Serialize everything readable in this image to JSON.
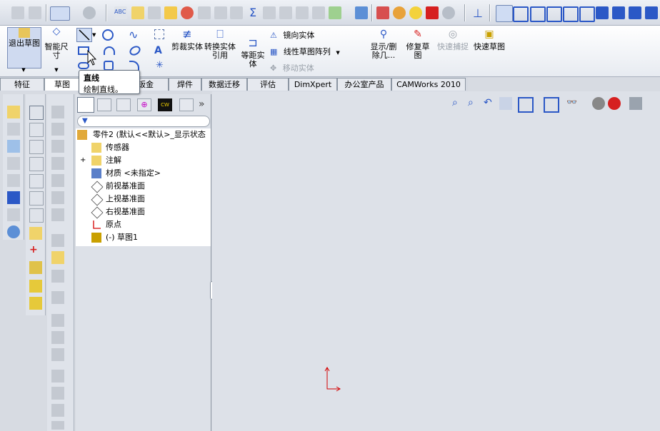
{
  "top_toolbar": {
    "icons": [
      "template-icon",
      "template2-icon",
      "select-arrow-icon",
      "options-icon",
      "spellcheck-icon",
      "measure-icon",
      "mass-properties-icon",
      "section-icon",
      "dimxpert-icon",
      "check-icon",
      "check2-icon",
      "equation-icon",
      "relation-icon",
      "fix-icon",
      "move-icon",
      "rotate-icon",
      "check-relations-icon",
      "table-icon",
      "evaluate-icon",
      "curvature-icon",
      "zebra-icon",
      "color-icon",
      "render-icon",
      "view-normal-icon",
      "view-front-icon",
      "view-back-icon",
      "view-left-icon",
      "view-right-icon",
      "view-top-icon",
      "view-iso-icon",
      "view-shade-icon",
      "view-hidden-icon"
    ]
  },
  "ribbon": {
    "exit_sketch": "退出草图",
    "smart_dimension": "智能尺寸",
    "trim_entities": "剪裁实体",
    "convert_entities": "转换实体引用",
    "offset_entities": "等距实体",
    "mirror_entities": "镜向实体",
    "linear_pattern": "线性草图阵列",
    "move_entities": "移动实体",
    "display_delete": "显示/删除几...",
    "repair_sketch": "修复草图",
    "rapid_snap": "快速捕捉",
    "rapid_sketch": "快速草图"
  },
  "command_tabs": [
    "特征",
    "草图",
    "钣金",
    "焊件",
    "数据迁移",
    "评估",
    "DimXpert",
    "办公室产品",
    "CAMWorks 2010"
  ],
  "tooltip": {
    "title": "直线",
    "desc": "绘制直线。"
  },
  "feature_manager": {
    "tabs": [
      "featuremanager-tab",
      "propertymanager-tab",
      "configurationmanager-tab",
      "dimxpert-tab",
      "camworks-tab",
      "display-tab"
    ],
    "more": "»",
    "tree": [
      {
        "label": "零件2  (默认<<默认>_显示状态",
        "icon": "part-icon",
        "level": 0
      },
      {
        "label": "传感器",
        "icon": "sensor-icon",
        "level": 1
      },
      {
        "label": "注解",
        "icon": "annotation-icon",
        "level": 1,
        "expander": "+"
      },
      {
        "label": "材质 <未指定>",
        "icon": "material-icon",
        "level": 1
      },
      {
        "label": "前视基准面",
        "icon": "plane-icon",
        "level": 1
      },
      {
        "label": "上视基准面",
        "icon": "plane-icon",
        "level": 1
      },
      {
        "label": "右视基准面",
        "icon": "plane-icon",
        "level": 1
      },
      {
        "label": "原点",
        "icon": "origin-icon",
        "level": 1
      },
      {
        "label": "(-) 草图1",
        "icon": "sketch-icon",
        "level": 1
      }
    ]
  },
  "colors": {
    "accent_blue": "#2b58c6",
    "origin_red": "#d40000"
  }
}
